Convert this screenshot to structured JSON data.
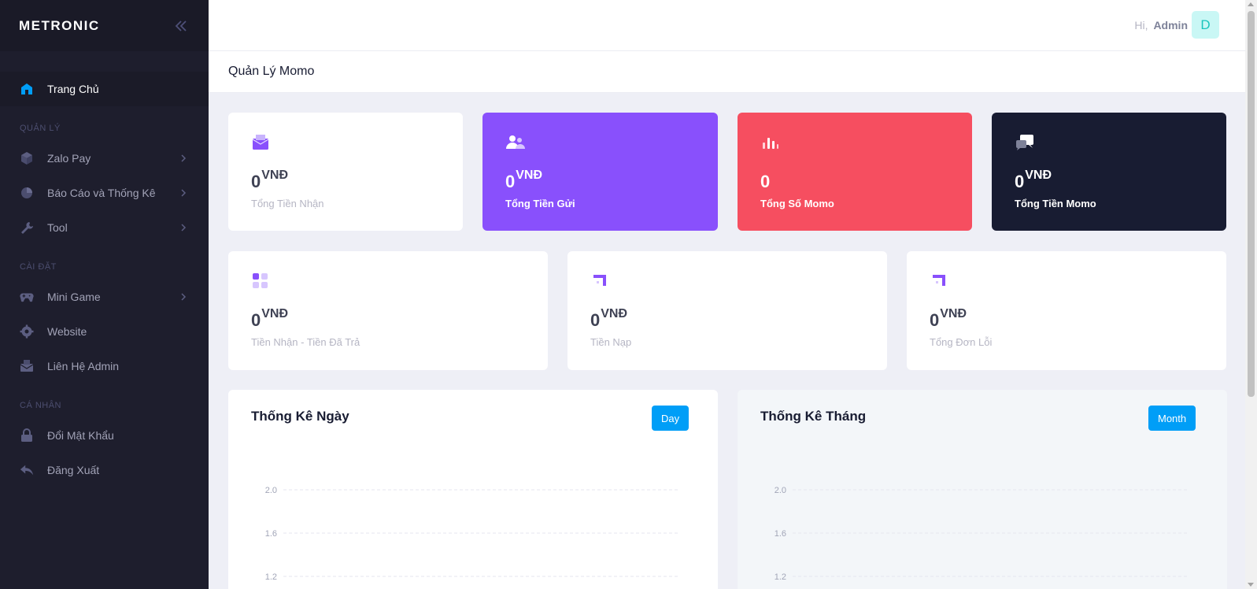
{
  "brand": "METRONIC",
  "sidebar": {
    "home": {
      "label": "Trang Chủ",
      "icon": "home-icon"
    },
    "section_manage": "QUẢN LÝ",
    "manage_items": [
      {
        "label": "Zalo Pay",
        "icon": "box-icon"
      },
      {
        "label": "Báo Cáo và Thống Kê",
        "icon": "pie-chart-icon"
      },
      {
        "label": "Tool",
        "icon": "wrench-icon"
      }
    ],
    "section_settings": "CÀI ĐẶT",
    "settings_items": [
      {
        "label": "Mini Game",
        "icon": "gamepad-icon"
      },
      {
        "label": "Website",
        "icon": "gear-icon"
      },
      {
        "label": "Liên Hệ Admin",
        "icon": "mail-icon"
      }
    ],
    "section_personal": "CÁ NHÂN",
    "personal_items": [
      {
        "label": "Đổi Mật Khẩu",
        "icon": "lock-icon"
      },
      {
        "label": "Đăng Xuất",
        "icon": "logout-icon"
      }
    ]
  },
  "header": {
    "greeting": "Hi,",
    "user": "Admin",
    "avatar_letter": "D"
  },
  "page_title": "Quản Lý Momo",
  "stats": [
    {
      "value": "0",
      "unit": "VNĐ",
      "label": "Tổng Tiền Nhận",
      "icon": "envelope-icon"
    },
    {
      "value": "0",
      "unit": "VNĐ",
      "label": "Tổng Tiền Gửi",
      "icon": "users-icon",
      "color": "#8950fc"
    },
    {
      "value": "0",
      "unit": "",
      "label": "Tổng Số Momo",
      "icon": "bar-chart-icon",
      "color": "#f64e60"
    },
    {
      "value": "0",
      "unit": "VNĐ",
      "label": "Tổng Tiền Momo",
      "icon": "chat-icon",
      "color": "#181c32"
    },
    {
      "value": "0",
      "unit": "VNĐ",
      "label": "Tiền Nhận - Tiền Đã Trả",
      "icon": "grid-icon"
    },
    {
      "value": "0",
      "unit": "VNĐ",
      "label": "Tiền Nạp",
      "icon": "corner-icon"
    },
    {
      "value": "0",
      "unit": "VNĐ",
      "label": "Tổng Đơn Lỗi",
      "icon": "corner-icon"
    }
  ],
  "charts": {
    "day": {
      "title": "Thống Kê Ngày",
      "button": "Day"
    },
    "month": {
      "title": "Thống Kê Tháng",
      "button": "Month"
    }
  },
  "chart_data": [
    {
      "type": "line",
      "title": "Thống Kê Ngày",
      "yticks": [
        "2.0",
        "1.6",
        "1.2"
      ],
      "grid": true,
      "series": []
    },
    {
      "type": "line",
      "title": "Thống Kê Tháng",
      "yticks": [
        "2.0",
        "1.6",
        "1.2"
      ],
      "grid": true,
      "series": []
    }
  ],
  "colors": {
    "accent": "#009ef7",
    "purple": "#8950fc",
    "red": "#f64e60",
    "dark": "#181c32",
    "sidebar": "#1e1e2d"
  }
}
